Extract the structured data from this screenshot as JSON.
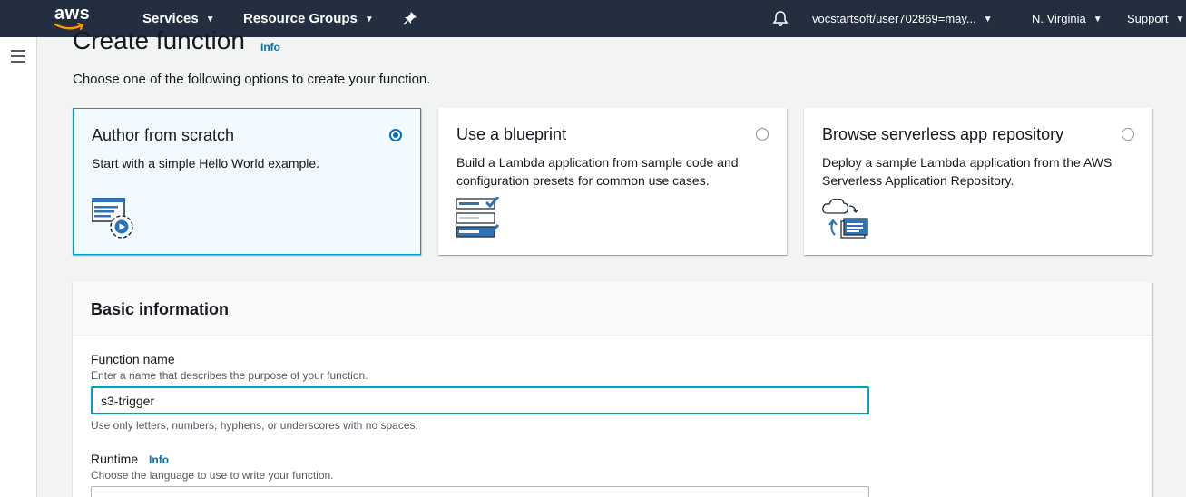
{
  "topnav": {
    "logo": "aws",
    "services": "Services",
    "resource_groups": "Resource Groups",
    "account": "vocstartsoft/user702869=may...",
    "region": "N. Virginia",
    "support": "Support"
  },
  "page": {
    "title": "Create function",
    "title_info": "Info",
    "subtitle": "Choose one of the following options to create your function."
  },
  "options": [
    {
      "title": "Author from scratch",
      "desc": "Start with a simple Hello World example.",
      "selected": true,
      "icon": "code-gear-icon"
    },
    {
      "title": "Use a blueprint",
      "desc": "Build a Lambda application from sample code and configuration presets for common use cases.",
      "selected": false,
      "icon": "checklist-icon"
    },
    {
      "title": "Browse serverless app repository",
      "desc": "Deploy a sample Lambda application from the AWS Serverless Application Repository.",
      "selected": false,
      "icon": "cloud-repo-icon"
    }
  ],
  "basic_info": {
    "heading": "Basic information",
    "function_name": {
      "label": "Function name",
      "hint": "Enter a name that describes the purpose of your function.",
      "value": "s3-trigger",
      "rule": "Use only letters, numbers, hyphens, or underscores with no spaces."
    },
    "runtime": {
      "label": "Runtime",
      "info": "Info",
      "hint": "Choose the language to use to write your function."
    }
  },
  "colors": {
    "nav_bg": "#232f3e",
    "accent": "#0073bb",
    "focus": "#00a1c9",
    "aws_orange": "#ff9900"
  }
}
